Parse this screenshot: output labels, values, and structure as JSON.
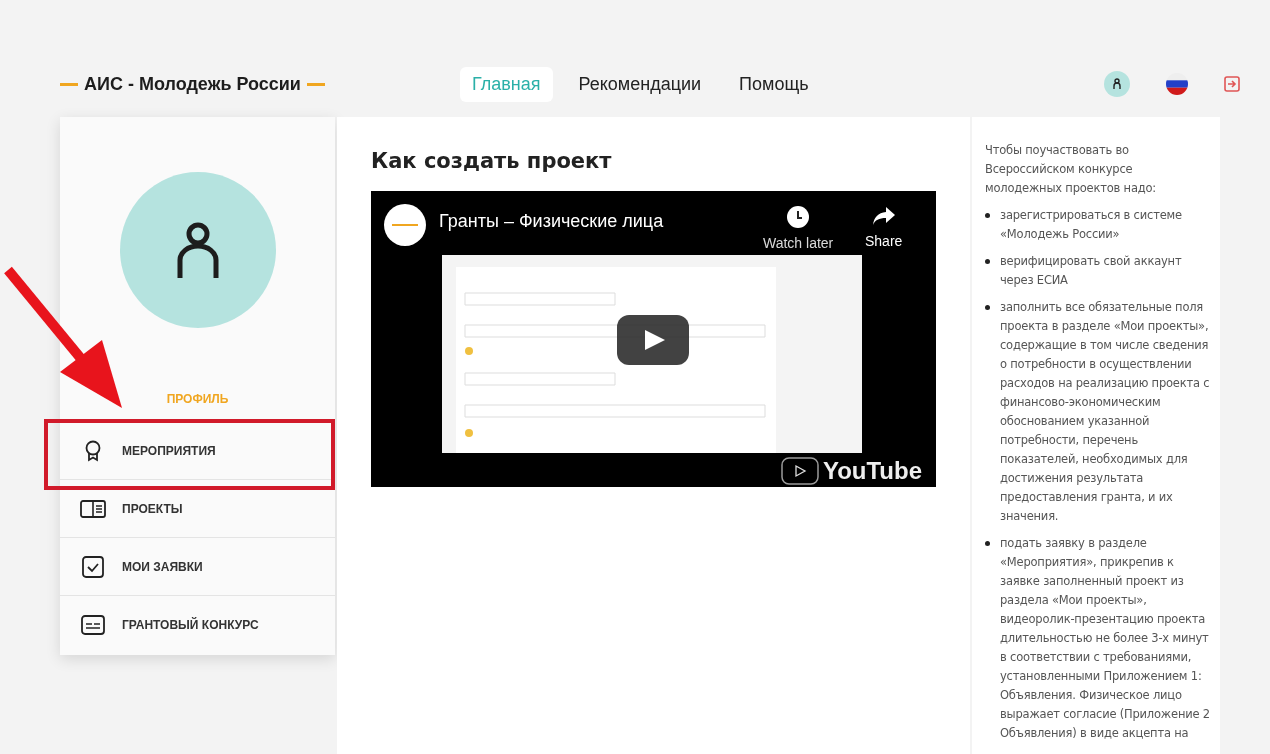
{
  "header": {
    "logo": "АИС - Молодежь России",
    "nav": [
      {
        "label": "Главная",
        "selected": true
      },
      {
        "label": "Рекомендации",
        "selected": false
      },
      {
        "label": "Помощь",
        "selected": false
      }
    ]
  },
  "sidebar": {
    "profile_label": "ПРОФИЛЬ",
    "items": [
      {
        "label": "МЕРОПРИЯТИЯ",
        "kind": "award",
        "highlighted": true
      },
      {
        "label": "ПРОЕКТЫ",
        "kind": "projects",
        "highlighted": false
      },
      {
        "label": "МОИ ЗАЯВКИ",
        "kind": "check",
        "highlighted": false
      },
      {
        "label": "ГРАНТОВЫЙ КОНКУРС",
        "kind": "card",
        "highlighted": false
      }
    ]
  },
  "main": {
    "title": "Как создать проект",
    "video": {
      "title": "Гранты – Физические лица",
      "watch_later": "Watch later",
      "share": "Share",
      "brand": "YouTube"
    }
  },
  "info": {
    "intro": "Чтобы поучаствовать во Всероссийском конкурсе молодежных проектов надо:",
    "steps": [
      "зарегистрироваться в системе «Молодежь России»",
      "верифицировать свой аккаунт через ЕСИА",
      "заполнить все обязательные поля проекта в разделе «Мои проекты», содержащие в том числе сведения о потребности в осуществлении расходов на реализацию проекта с финансово-экономическим обоснованием указанной потребности, перечень показателей, необходимых для достижения результата предоставления гранта, и их значения.",
      "подать заявку в разделе «Мероприятия», прикрепив к заявке заполненный проект из раздела «Мои проекты», видеоролик-презентацию проекта длительностью не более 3-х минут в соответствии с требованиями, установленными Приложением 1: Объявления. Физическое лицо выражает согласие (Приложение 2 Объявления) в виде акцепта на"
    ]
  }
}
